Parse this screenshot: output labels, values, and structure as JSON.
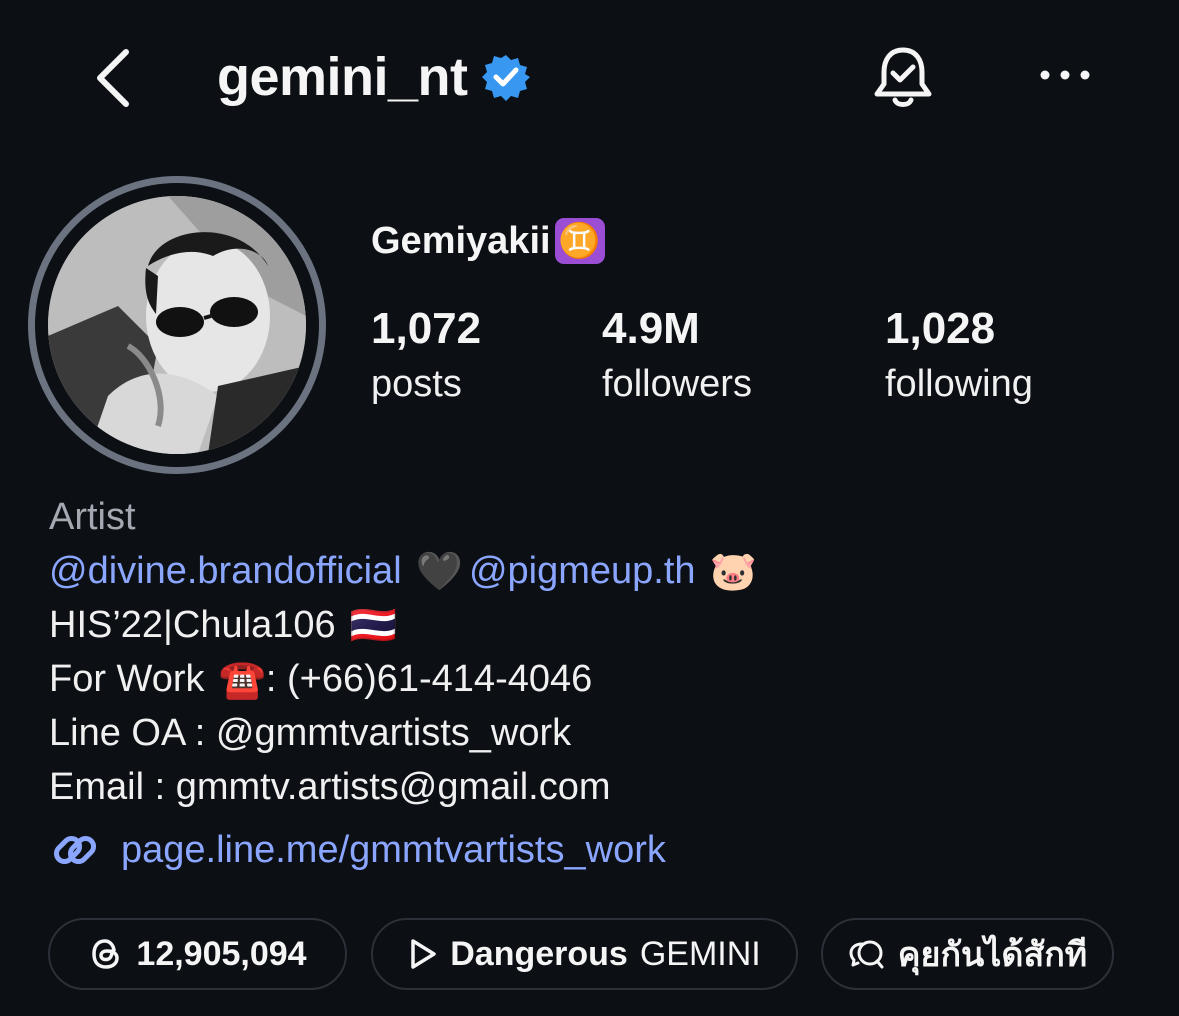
{
  "header": {
    "username": "gemini_nt",
    "back_icon": "chevron-left-icon",
    "verified_icon": "verified-badge-icon",
    "bell_icon": "notification-bell-icon",
    "more_icon": "more-horizontal-icon",
    "verified_color": "#3897f0"
  },
  "profile": {
    "display_name": "Gemiyakii",
    "name_emoji": "♊",
    "stats": [
      {
        "value": "1,072",
        "label": "posts"
      },
      {
        "value": "4.9M",
        "label": "followers"
      },
      {
        "value": "1,028",
        "label": "following"
      }
    ]
  },
  "bio": {
    "category": "Artist",
    "mention_1": "@divine.brandofficial",
    "heart_emoji": "🖤",
    "mention_2": "@pigmeup.th",
    "pig_emoji": "🐷",
    "line_2": "HIS’22|Chula106",
    "flag_emoji": "🇹🇭",
    "work_prefix": "For Work",
    "phone_emoji": "☎️",
    "work_suffix": ": (+66)61-414-4046",
    "line_oa": "Line OA : @gmmtvartists_work",
    "email": "Email : gmmtv.artists@gmail.com"
  },
  "link": {
    "icon": "link-icon",
    "text": "page.line.me/gmmtvartists_work"
  },
  "chips": {
    "threads": {
      "icon": "threads-icon",
      "count": "12,905,094"
    },
    "music": {
      "icon": "play-icon",
      "title": "Dangerous",
      "artist": "GEMINI"
    },
    "note": {
      "icon": "chat-bubble-icon",
      "text": "คุยกันได้สักที"
    }
  },
  "colors": {
    "background": "#0c0f14",
    "link": "#8aa6ff",
    "muted": "#a4a8b0",
    "chip_border": "#2c3038",
    "avatar_ring": "#6b7381"
  }
}
